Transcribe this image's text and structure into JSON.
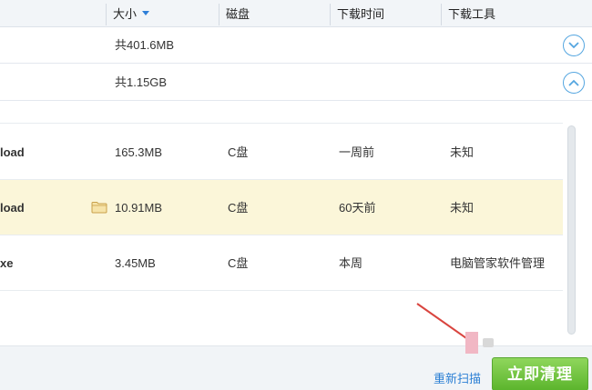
{
  "columns": {
    "size": "大小",
    "disk": "磁盘",
    "download_time": "下载时间",
    "download_tool": "下载工具"
  },
  "groups": [
    {
      "total": "共401.6MB",
      "toggle_icon": "chevron-down-circle-icon"
    },
    {
      "total": "共1.15GB",
      "toggle_icon": "chevron-up-circle-icon"
    }
  ],
  "rows": [
    {
      "name": "load",
      "size": "165.3MB",
      "disk": "C盘",
      "time": "一周前",
      "tool": "未知",
      "selected": false
    },
    {
      "name": "load",
      "size": "10.91MB",
      "disk": "C盘",
      "time": "60天前",
      "tool": "未知",
      "selected": true
    },
    {
      "name": "xe",
      "size": "3.45MB",
      "disk": "C盘",
      "time": "本周",
      "tool": "电脑管家软件管理",
      "selected": false
    }
  ],
  "footer": {
    "rescan_label": "重新扫描",
    "clean_label": "立即清理"
  },
  "colors": {
    "accent": "#2e7fd8",
    "selected_row": "#fbf6d9",
    "clean_button": "#5cb52d",
    "annotation": "#d9453f"
  }
}
